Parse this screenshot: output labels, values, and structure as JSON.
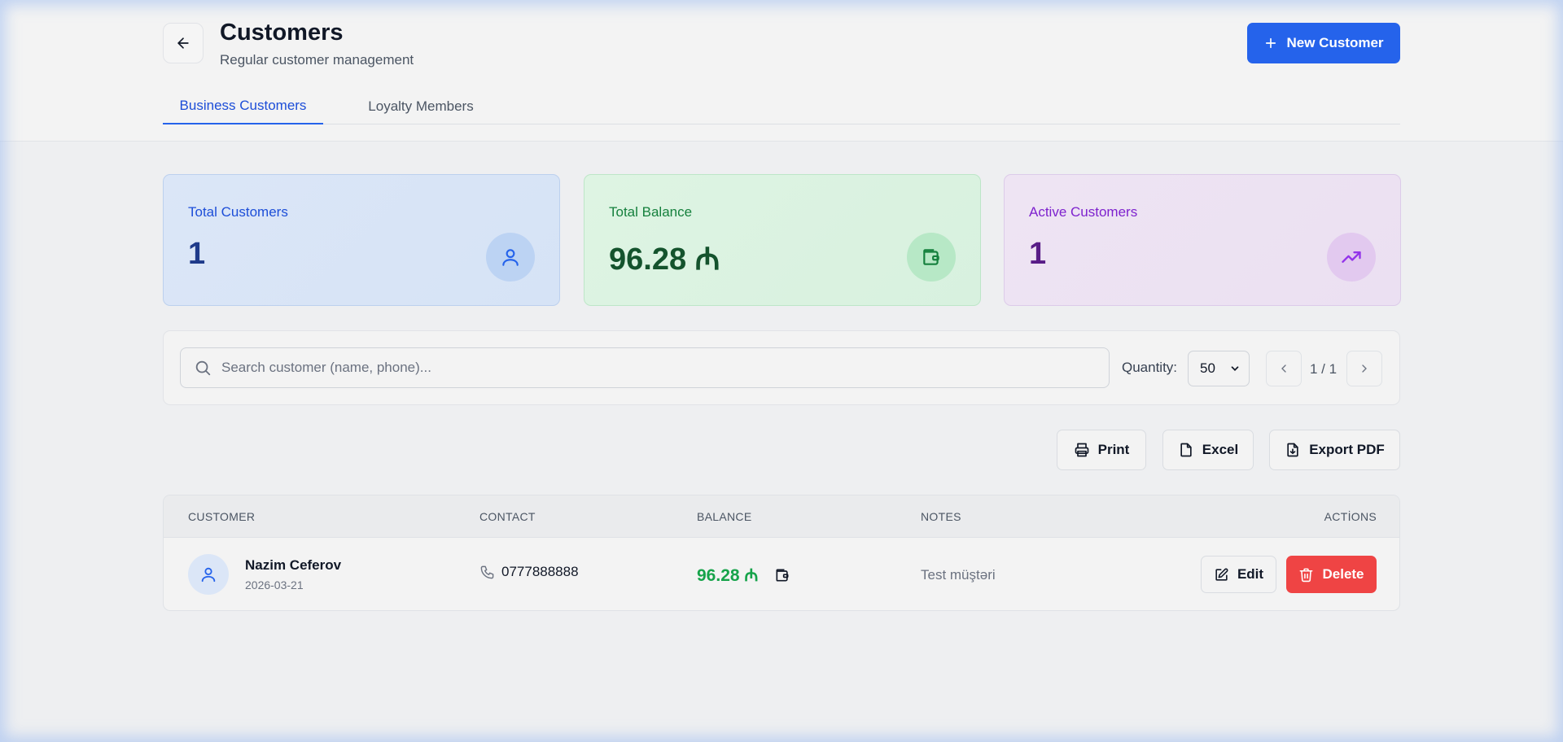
{
  "header": {
    "title": "Customers",
    "subtitle": "Regular customer management",
    "new_button_label": "New Customer"
  },
  "tabs": [
    {
      "label": "Business Customers",
      "active": true
    },
    {
      "label": "Loyalty Members",
      "active": false
    }
  ],
  "stats": [
    {
      "label": "Total Customers",
      "value": "1",
      "icon": "user-icon"
    },
    {
      "label": "Total Balance",
      "value": "96.28 ₼",
      "icon": "wallet-icon"
    },
    {
      "label": "Active Customers",
      "value": "1",
      "icon": "trending-up-icon"
    }
  ],
  "search": {
    "placeholder": "Search customer (name, phone)...",
    "value": ""
  },
  "pagination": {
    "quantity_label": "Quantity:",
    "quantity_value": "50",
    "page_indicator": "1 / 1"
  },
  "toolbar": {
    "print_label": "Print",
    "excel_label": "Excel",
    "pdf_label": "Export PDF"
  },
  "table": {
    "columns": [
      "CUSTOMER",
      "CONTACT",
      "BALANCE",
      "NOTES",
      "ACTİONS"
    ],
    "rows": [
      {
        "name": "Nazim Ceferov",
        "date": "2026-03-21",
        "phone": "0777888888",
        "balance": "96.28 ₼",
        "notes": "Test müştəri",
        "edit_label": "Edit",
        "delete_label": "Delete"
      }
    ]
  },
  "colors": {
    "accent": "#2563eb",
    "balance_green": "#16a34a",
    "delete_red": "#ef4444"
  }
}
